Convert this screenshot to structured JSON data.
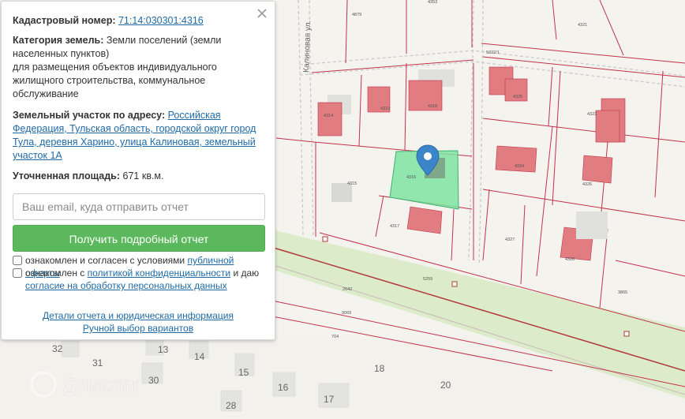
{
  "panel": {
    "cadastral_label": "Кадастровый номер:",
    "cadastral_number": "71:14:030301:4316",
    "category_label": "Категория земель:",
    "category_value_line1": "Земли поселений (земли",
    "category_value_line2": "населенных пунктов)",
    "category_value_line3": "для размещения объектов индивидуального",
    "category_value_line4": "жилищного строительства, коммунальное",
    "category_value_line5": "обслуживание",
    "address_label": "Земельный участок по адресу:",
    "address_line1": "Российская",
    "address_line2": "Федерация, Тульская область, городской округ город",
    "address_line3": "Тула, деревня Харино, улица Калиновая, земельный",
    "address_line4": "участок 1А",
    "area_label": "Уточненная площадь:",
    "area_value": "671 кв.м.",
    "email_placeholder": "Ваш email, куда отправить отчет",
    "submit_label": "Получить подробный отчет",
    "consent1_text": "ознакомлен и согласен с условиями",
    "consent1_link": "публичной оферты",
    "consent2_text": "ознакомлен с",
    "consent2_link": "политикой конфиденциальности",
    "consent2_mid": "и даю",
    "consent2_link2": "согласие на обработку персональных данных",
    "link_details": "Детали отчета и юридическая информация",
    "link_manual": "Ручной выбор вариантов"
  },
  "map": {
    "street_label": "Калиновая ул.",
    "watermark": "Домклик",
    "parcel_labels": [
      "4879",
      "4353",
      "4321",
      "5322/1",
      "4314",
      "4315",
      "4316",
      "4317",
      "4318",
      "4319",
      "4323",
      "4324",
      "4325",
      "4326",
      "4327",
      "4328",
      "5259",
      "2642",
      "9069",
      "704",
      "3865"
    ],
    "house_numbers": [
      "32",
      "31",
      "13",
      "14",
      "15",
      "16",
      "17",
      "18",
      "20",
      "30",
      "28"
    ],
    "selected_parcel": "4316"
  },
  "colors": {
    "accent_green": "#5cb85c",
    "link_blue": "#1f6aa6",
    "parcel_line": "#c2334a",
    "selected_fill": "#7fe3a2",
    "building": "#e17c80",
    "marker": "#3a86c8"
  }
}
